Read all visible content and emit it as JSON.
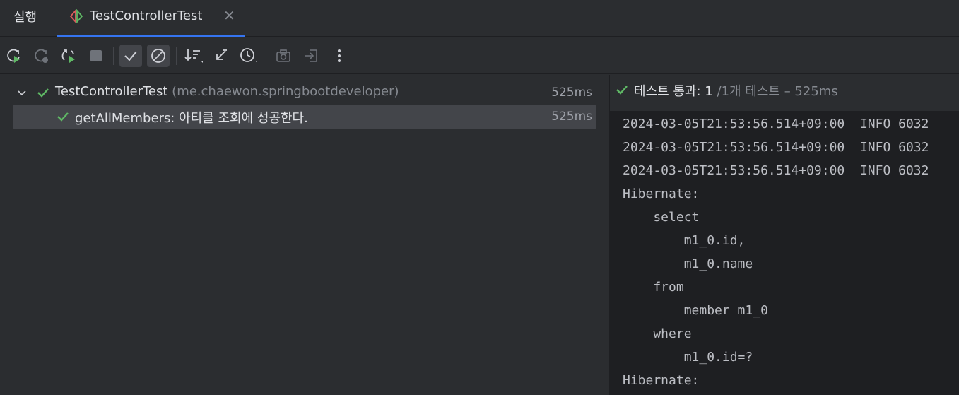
{
  "tabs": {
    "run_label": "실행",
    "active_label": "TestControllerTest",
    "close_glyph": "✕"
  },
  "toolbar": {
    "buttons": [
      {
        "icon": "rerun-icon"
      },
      {
        "icon": "rerun-failed-icon"
      },
      {
        "icon": "toggle-auto-test-icon"
      },
      {
        "icon": "stop-icon"
      },
      {
        "icon": "show-passed-icon"
      },
      {
        "icon": "show-ignored-icon"
      },
      {
        "icon": "sort-icon"
      },
      {
        "icon": "collapse-icon"
      },
      {
        "icon": "history-icon"
      },
      {
        "icon": "screenshot-icon"
      },
      {
        "icon": "import-icon"
      },
      {
        "icon": "more-icon"
      }
    ]
  },
  "tree": {
    "root": {
      "name": "TestControllerTest",
      "package": "(me.chaewon.springbootdeveloper)",
      "time": "525ms"
    },
    "child": {
      "name": "getAllMembers: 아티클 조회에 성공한다.",
      "time": "525ms"
    }
  },
  "summary": {
    "main": "테스트 통과: 1",
    "sub": "/1개 테스트 – 525ms"
  },
  "console": {
    "lines": [
      "2024-03-05T21:53:56.514+09:00  INFO 6032",
      "2024-03-05T21:53:56.514+09:00  INFO 6032",
      "2024-03-05T21:53:56.514+09:00  INFO 6032",
      "Hibernate:",
      "    select",
      "        m1_0.id,",
      "        m1_0.name",
      "    from",
      "        member m1_0",
      "    where",
      "        m1_0.id=?",
      "Hibernate:"
    ]
  },
  "colors": {
    "pass_green": "#5fb865",
    "accent_blue": "#3574f0",
    "background": "#2b2d30",
    "console_background": "#1e1f22"
  }
}
